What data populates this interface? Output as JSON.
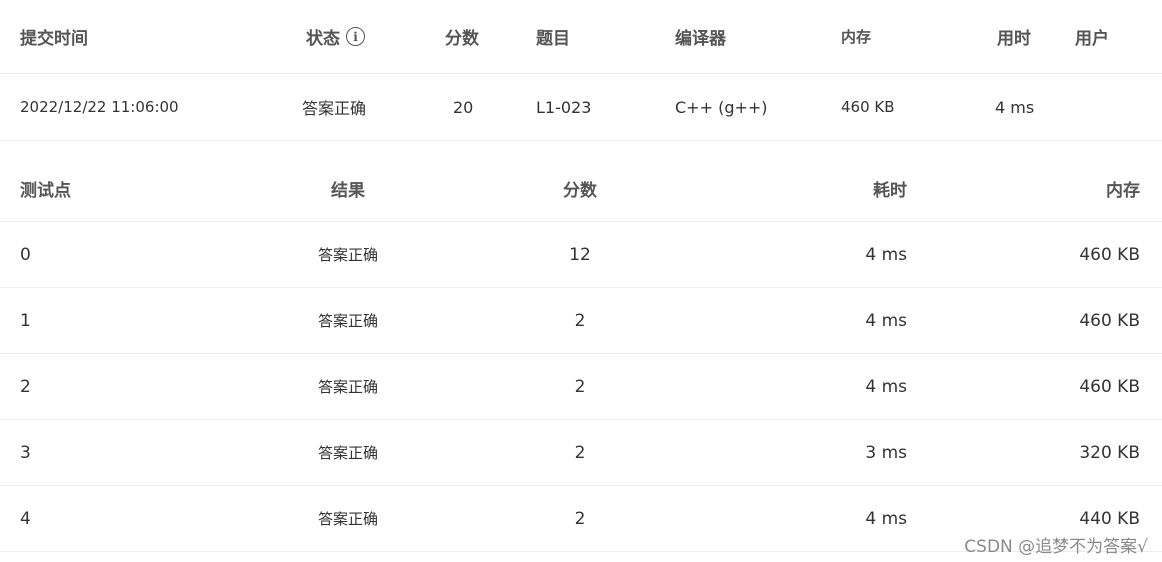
{
  "submission": {
    "headers": {
      "time": "提交时间",
      "status": "状态",
      "score": "分数",
      "problem": "题目",
      "compiler": "编译器",
      "memory": "内存",
      "duration": "用时",
      "user": "用户"
    },
    "row": {
      "time": "2022/12/22 11:06:00",
      "status": "答案正确",
      "score": "20",
      "problem": "L1-023",
      "compiler": "C++ (g++)",
      "memory": "460 KB",
      "duration": "4 ms",
      "user": ""
    }
  },
  "testcases": {
    "headers": {
      "point": "测试点",
      "result": "结果",
      "score": "分数",
      "time": "耗时",
      "memory": "内存"
    },
    "rows": [
      {
        "point": "0",
        "result": "答案正确",
        "score": "12",
        "time": "4 ms",
        "memory": "460 KB"
      },
      {
        "point": "1",
        "result": "答案正确",
        "score": "2",
        "time": "4 ms",
        "memory": "460 KB"
      },
      {
        "point": "2",
        "result": "答案正确",
        "score": "2",
        "time": "4 ms",
        "memory": "460 KB"
      },
      {
        "point": "3",
        "result": "答案正确",
        "score": "2",
        "time": "3 ms",
        "memory": "320 KB"
      },
      {
        "point": "4",
        "result": "答案正确",
        "score": "2",
        "time": "4 ms",
        "memory": "440 KB"
      }
    ]
  },
  "watermark": "CSDN @追梦不为答案√",
  "icons": {
    "status_info": "info-icon"
  },
  "colors": {
    "accepted": "#e53935",
    "link": "#1e88e5",
    "header_text": "#555555",
    "divider": "#ececec"
  }
}
